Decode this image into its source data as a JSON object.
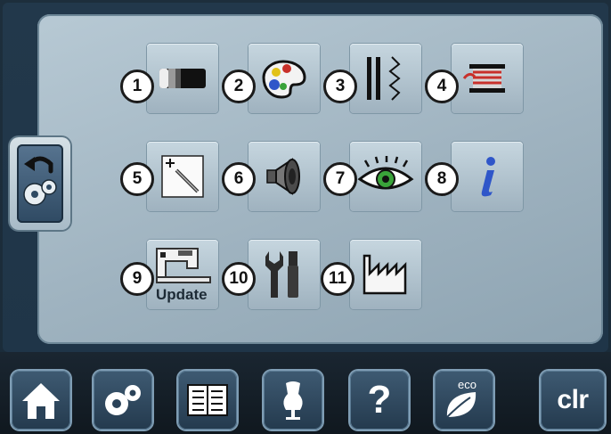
{
  "setup": {
    "tiles": [
      {
        "number": "1",
        "icon": "screen-contrast-icon"
      },
      {
        "number": "2",
        "icon": "color-palette-icon"
      },
      {
        "number": "3",
        "icon": "stitch-settings-icon"
      },
      {
        "number": "4",
        "icon": "bobbin-thread-icon"
      },
      {
        "number": "5",
        "icon": "calibration-pen-icon"
      },
      {
        "number": "6",
        "icon": "speaker-icon"
      },
      {
        "number": "7",
        "icon": "eye-icon"
      },
      {
        "number": "8",
        "icon": "info-icon"
      },
      {
        "number": "9",
        "icon": "machine-update-icon",
        "label": "Update"
      },
      {
        "number": "10",
        "icon": "service-tools-icon"
      },
      {
        "number": "11",
        "icon": "factory-icon"
      }
    ],
    "side_tab": {
      "icon": "setup-back-icon"
    }
  },
  "bottom_bar": {
    "buttons": [
      {
        "icon": "home-icon"
      },
      {
        "icon": "setup-gears-icon"
      },
      {
        "icon": "tutorial-book-icon"
      },
      {
        "icon": "dress-form-icon"
      },
      {
        "icon": "help-icon",
        "label": "?"
      },
      {
        "icon": "eco-leaf-icon",
        "label": "eco"
      },
      {
        "icon": "clear-icon",
        "label": "clr"
      }
    ]
  },
  "colors": {
    "panel": "#a9bcc8",
    "background": "#1d2e3c",
    "accent_blue": "#2f56c9",
    "accent_red": "#c8302a",
    "eye_green": "#3aa33a"
  }
}
